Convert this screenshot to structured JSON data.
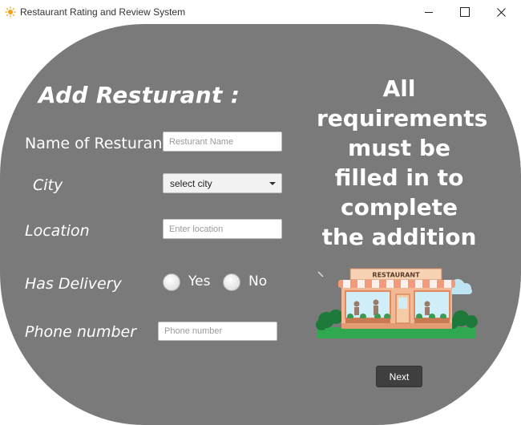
{
  "window": {
    "title": "Restaurant Rating and Review System",
    "minimize_icon": "minimize-icon",
    "maximize_icon": "maximize-icon",
    "close_icon": "close-icon",
    "app_icon": "sun-icon"
  },
  "form": {
    "heading": "Add Resturant :",
    "name_label": "Name of Resturant",
    "name_placeholder": "Resturant Name",
    "city_label": "City",
    "city_value": "select city",
    "location_label": "Location",
    "location_placeholder": "Enter location",
    "delivery_label": "Has Delivery",
    "delivery_yes": "Yes",
    "delivery_no": "No",
    "phone_label": "Phone number",
    "phone_placeholder": "Phone number"
  },
  "message": {
    "line1": "All",
    "line2": "requirements",
    "line3": "must be",
    "line4": "filled in to",
    "line5": "complete",
    "line6": "the addition"
  },
  "illustration": {
    "sign": "RESTAURANT",
    "icon": "restaurant-storefront-icon"
  },
  "actions": {
    "next_label": "Next"
  },
  "colors": {
    "panel": "#7a7a7a",
    "button": "#3f3f3f",
    "text": "#ffffff"
  }
}
